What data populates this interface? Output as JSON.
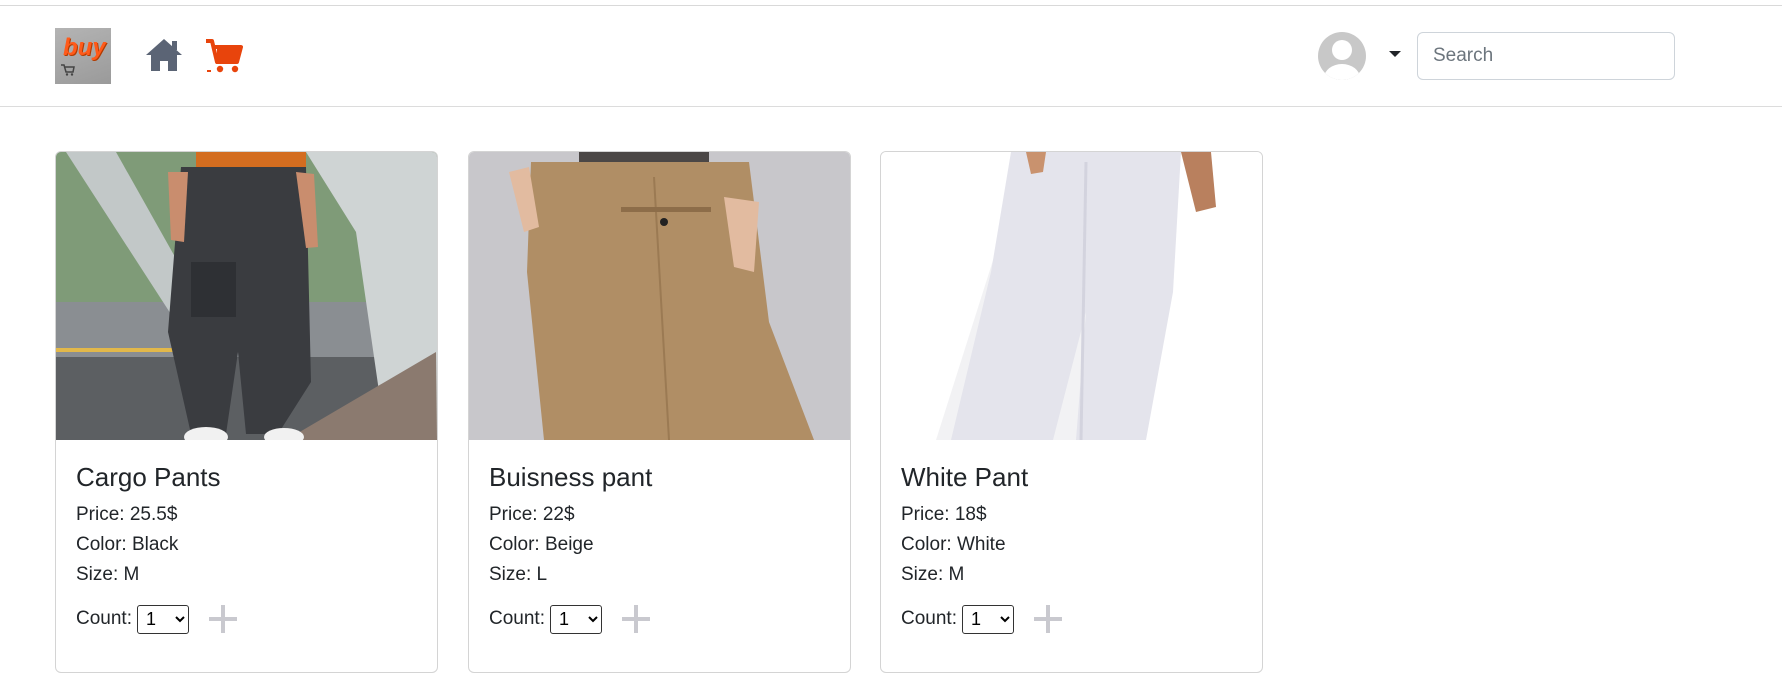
{
  "header": {
    "logo_text": "buy",
    "search_placeholder": "Search",
    "accent_color": "#e8440c"
  },
  "products": [
    {
      "title": "Cargo Pants",
      "price": "Price: 25.5$",
      "color": "Color: Black",
      "size": "Size: M",
      "count_label": "Count:",
      "count_value": "1"
    },
    {
      "title": "Buisness pant",
      "price": "Price: 22$",
      "color": "Color: Beige",
      "size": "Size: L",
      "count_label": "Count:",
      "count_value": "1"
    },
    {
      "title": "White Pant",
      "price": "Price: 18$",
      "color": "Color: White",
      "size": "Size: M",
      "count_label": "Count:",
      "count_value": "1"
    }
  ]
}
